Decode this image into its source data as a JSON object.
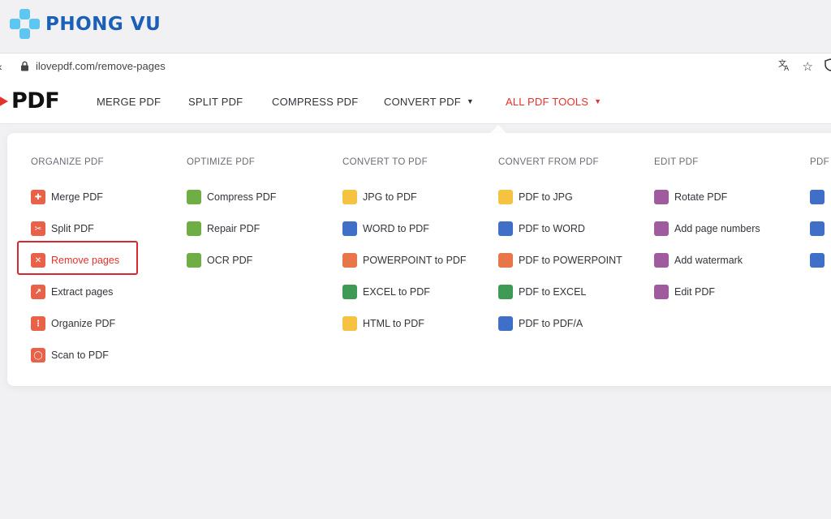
{
  "watermark": {
    "name": "PHONG VU"
  },
  "browser": {
    "url": "ilovepdf.com/remove-pages",
    "icons": [
      "back-icon",
      "lock-icon",
      "translate-icon",
      "star-icon",
      "shield-icon"
    ]
  },
  "site": {
    "logo_text": "PDF",
    "nav": [
      {
        "label": "MERGE PDF"
      },
      {
        "label": "SPLIT PDF"
      },
      {
        "label": "COMPRESS PDF"
      },
      {
        "label": "CONVERT PDF"
      },
      {
        "label": "ALL PDF TOOLS"
      }
    ],
    "accent": "#e5322d"
  },
  "menu": {
    "columns": [
      {
        "title": "ORGANIZE PDF",
        "tools": [
          {
            "label": "Merge PDF",
            "color": "#e8624a"
          },
          {
            "label": "Split PDF",
            "color": "#e8624a"
          },
          {
            "label": "Remove pages",
            "color": "#e8624a"
          },
          {
            "label": "Extract pages",
            "color": "#e8624a"
          },
          {
            "label": "Organize PDF",
            "color": "#e8624a"
          },
          {
            "label": "Scan to PDF",
            "color": "#e8624a"
          }
        ]
      },
      {
        "title": "OPTIMIZE PDF",
        "tools": [
          {
            "label": "Compress PDF",
            "color": "#6fae45"
          },
          {
            "label": "Repair PDF",
            "color": "#6fae45"
          },
          {
            "label": "OCR PDF",
            "color": "#6fae45"
          }
        ]
      },
      {
        "title": "CONVERT TO PDF",
        "tools": [
          {
            "label": "JPG to PDF",
            "color": "#f5c242"
          },
          {
            "label": "WORD to PDF",
            "color": "#3f6fc6"
          },
          {
            "label": "POWERPOINT to PDF",
            "color": "#e9764a"
          },
          {
            "label": "EXCEL to PDF",
            "color": "#3f9a55"
          },
          {
            "label": "HTML to PDF",
            "color": "#f5c242"
          }
        ]
      },
      {
        "title": "CONVERT FROM PDF",
        "tools": [
          {
            "label": "PDF to JPG",
            "color": "#f5c242"
          },
          {
            "label": "PDF to WORD",
            "color": "#3f6fc6"
          },
          {
            "label": "PDF to POWERPOINT",
            "color": "#e9764a"
          },
          {
            "label": "PDF to EXCEL",
            "color": "#3f9a55"
          },
          {
            "label": "PDF to PDF/A",
            "color": "#3f6fc6"
          }
        ]
      },
      {
        "title": "EDIT PDF",
        "tools": [
          {
            "label": "Rotate PDF",
            "color": "#a05a9e"
          },
          {
            "label": "Add page numbers",
            "color": "#a05a9e"
          },
          {
            "label": "Add watermark",
            "color": "#a05a9e"
          },
          {
            "label": "Edit PDF",
            "color": "#a05a9e"
          }
        ]
      },
      {
        "title": "PDF S",
        "tools": [
          {
            "label": "",
            "color": "#3f6fc6"
          },
          {
            "label": "",
            "color": "#3f6fc6"
          },
          {
            "label": "",
            "color": "#3f6fc6"
          }
        ]
      }
    ]
  }
}
